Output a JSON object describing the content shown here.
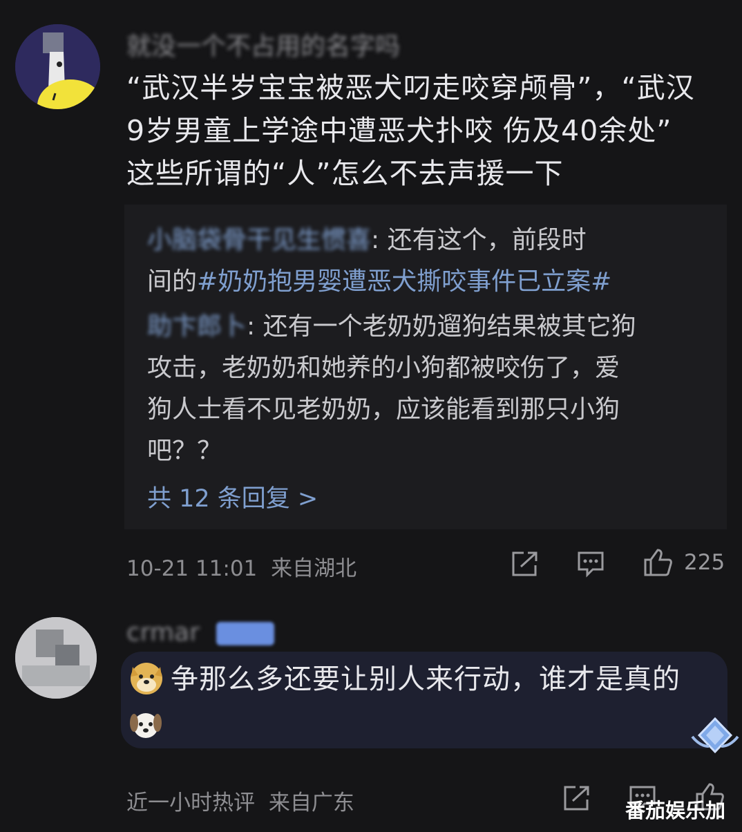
{
  "comment1": {
    "username": "就没一个不占用的名字吗",
    "lines": [
      "“武汉半岁宝宝被恶犬叼走咬穿颅骨”，“武汉",
      "9岁男童上学途中遭恶犬扑咬 伤及40余处”",
      "这些所谓的“人”怎么不去声援一下"
    ],
    "replies": [
      {
        "username": "小脑袋骨干见生惯喜",
        "text_before": ": 还有这个，前段时",
        "line2_prefix": "间的",
        "hashtag": "#奶奶抱男婴遭恶犬撕咬事件已立案#"
      },
      {
        "username": "助卞郎卜",
        "lines": [
          ": 还有一个老奶奶遛狗结果被其它狗",
          "攻击，老奶奶和她养的小狗都被咬伤了，爱",
          "狗人士看不见老奶奶，应该能看到那只小狗",
          "吧？？"
        ]
      }
    ],
    "more_replies": "共 12 条回复 >",
    "time": "10-21 11:01",
    "location": "来自湖北",
    "likes": "225",
    "icons": [
      "share-icon",
      "comment-icon",
      "like-icon"
    ]
  },
  "comment2": {
    "username": "crmar",
    "text": "争那么多还要让别人来行动，谁才是真的",
    "time": "近一小时热评",
    "location": "来自广东",
    "icons": [
      "doge-emoji",
      "dog-emoji",
      "badge-icon",
      "share-icon",
      "comment-icon",
      "like-icon"
    ]
  },
  "watermark": "番茄娱乐加"
}
